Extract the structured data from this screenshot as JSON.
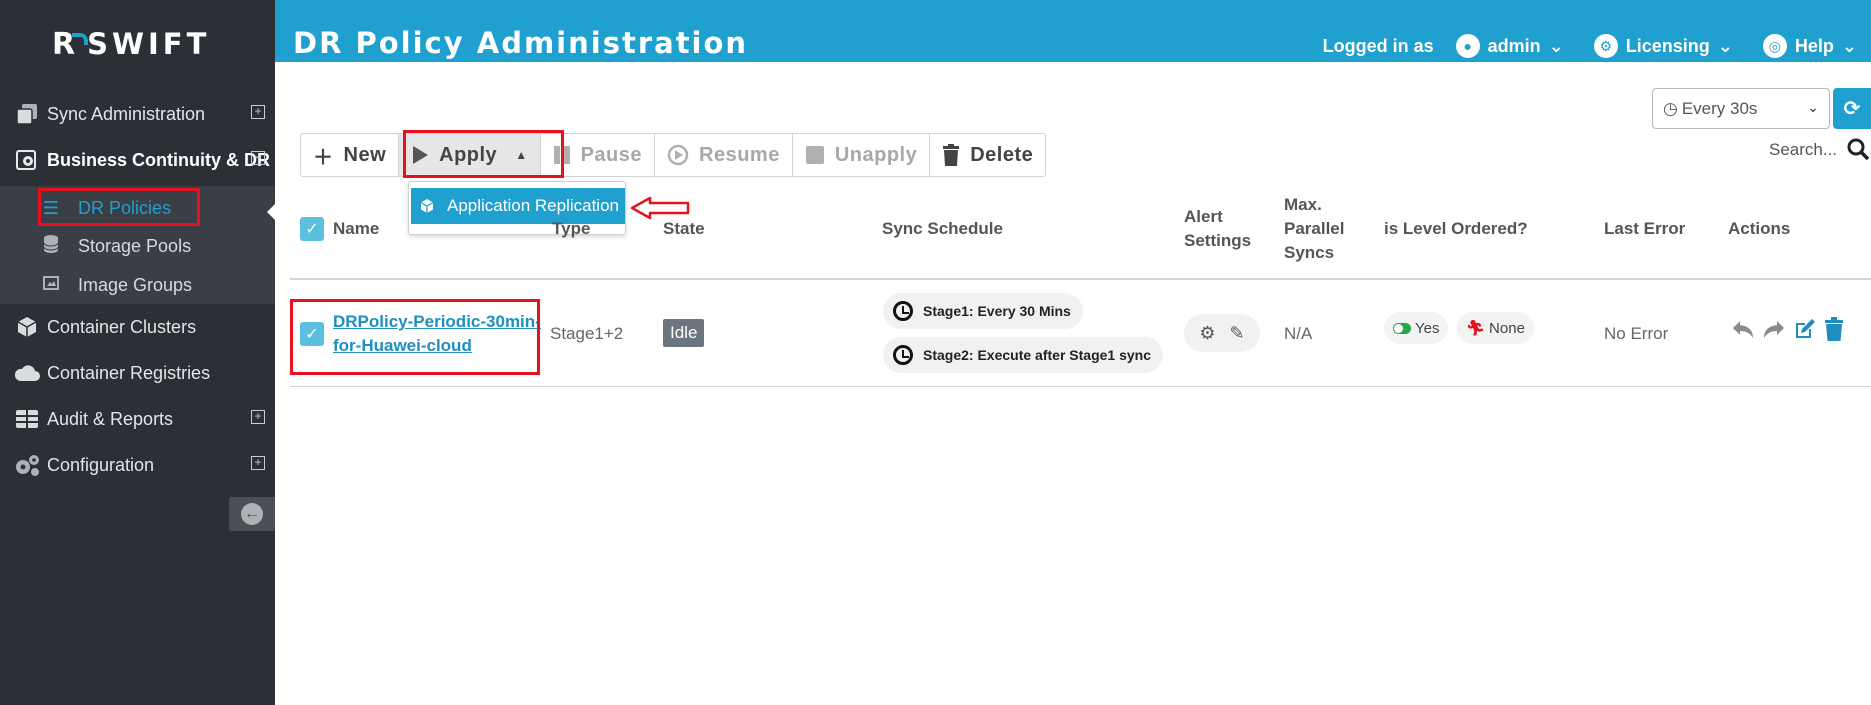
{
  "app": {
    "logo_text": "SWIFT",
    "logo_mark": "R"
  },
  "sidebar": {
    "items": [
      {
        "label": "Sync Administration",
        "icon": "copy-icon",
        "expand": "+"
      },
      {
        "label": "Business Continuity & DR",
        "icon": "gear-doc-icon",
        "expand": "−"
      },
      {
        "label": "Container Clusters",
        "icon": "cube-icon"
      },
      {
        "label": "Container Registries",
        "icon": "cloud-icon"
      },
      {
        "label": "Audit & Reports",
        "icon": "table-icon",
        "expand": "+"
      },
      {
        "label": "Configuration",
        "icon": "gears-icon",
        "expand": "+"
      }
    ],
    "subitems": [
      {
        "label": "DR Policies",
        "icon": "list-icon",
        "selected": true
      },
      {
        "label": "Storage Pools",
        "icon": "database-icon"
      },
      {
        "label": "Image Groups",
        "icon": "image-icon"
      }
    ]
  },
  "header": {
    "title": "DR Policy Administration",
    "logged_in_label": "Logged in as",
    "user": "admin",
    "licensing": "Licensing",
    "help": "Help"
  },
  "refresh": {
    "selected": "Every 30s"
  },
  "search": {
    "placeholder": "Search..."
  },
  "toolbar": {
    "new": "New",
    "apply": "Apply",
    "pause": "Pause",
    "resume": "Resume",
    "unapply": "Unapply",
    "delete": "Delete"
  },
  "apply_menu": {
    "items": [
      "Application Replication"
    ]
  },
  "table": {
    "columns": {
      "name": "Name",
      "type": "Type",
      "state": "State",
      "sync_schedule": "Sync Schedule",
      "alert_settings_1": "Alert",
      "alert_settings_2": "Settings",
      "max_parallel_1": "Max.",
      "max_parallel_2": "Parallel",
      "max_parallel_3": "Syncs",
      "level_ordered": "is Level Ordered?",
      "last_error": "Last Error",
      "actions": "Actions"
    },
    "rows": [
      {
        "name_line1": "DRPolicy-Periodic-30min-",
        "name_line2": "for-Huawei-cloud",
        "type": "Stage1+2",
        "state": "Idle",
        "schedule": [
          "Stage1: Every 30 Mins",
          "Stage2: Execute after Stage1 sync"
        ],
        "max_parallel": "N/A",
        "level_ordered": "Yes",
        "level_tag": "None",
        "last_error": "No Error"
      }
    ]
  },
  "colors": {
    "accent": "#1fa0cf",
    "sidebar_bg": "#2b3036",
    "highlight_red": "#e4131f",
    "idle_badge": "#6c757d"
  }
}
